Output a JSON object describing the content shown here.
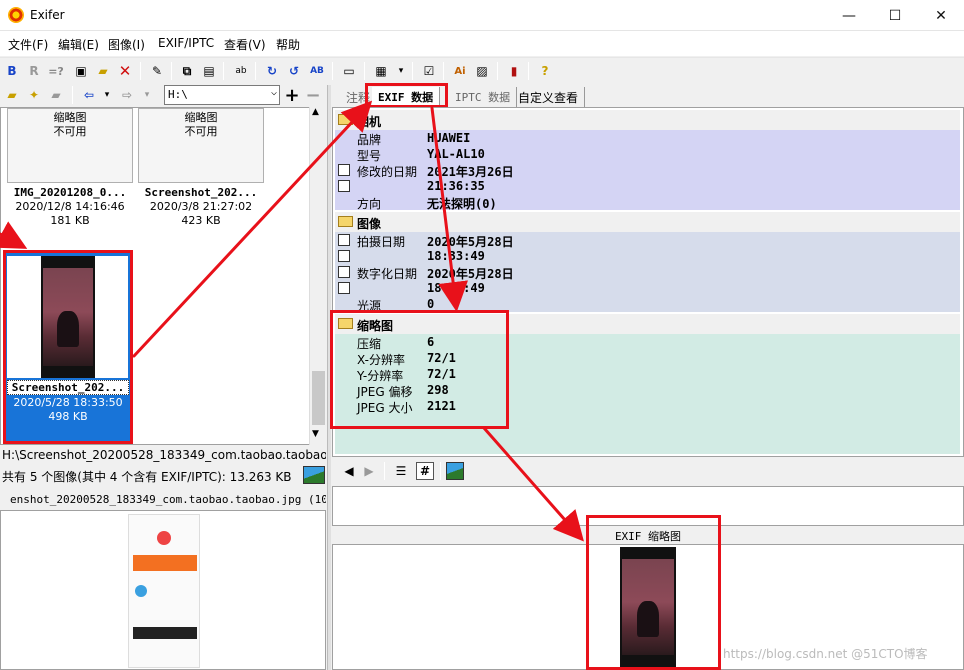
{
  "window": {
    "title": "Exifer",
    "minimize": "—",
    "maximize": "☐",
    "close": "✕"
  },
  "menu": [
    "文件(F)",
    "编辑(E)",
    "图像(I)",
    "EXIF/IPTC",
    "查看(V)",
    "帮助"
  ],
  "toolbar": {
    "btn_b": "B",
    "btn_r": "R",
    "btn_eq": "=?"
  },
  "path_combo": {
    "value": "H:\\"
  },
  "thumbnails": [
    {
      "placeholder": "缩略图\n不可用",
      "name": "IMG_20201208_0...",
      "date": "2020/12/8 14:16:46",
      "size": "181 KB"
    },
    {
      "placeholder": "缩略图\n不可用",
      "name": "Screenshot_202...",
      "date": "2020/3/8 21:27:02",
      "size": "423 KB"
    },
    {
      "name": "Screenshot_202...",
      "date": "2020/5/28 18:33:50",
      "size": "498 KB"
    }
  ],
  "status": {
    "file_path": "H:\\Screenshot_20200528_183349_com.taobao.taobao.jp",
    "count": "共有 5 个图像(其中 4 个含有 EXIF/IPTC): 13.263 KB",
    "preview_name": "enshot_20200528_183349_com.taobao.taobao.jpg (1080x2"
  },
  "tabs": [
    "注释",
    "EXIF 数据",
    "IPTC 数据",
    "自定义查看"
  ],
  "exif": {
    "camera": {
      "title": "相机",
      "rows": [
        {
          "k": "品牌",
          "v": "HUAWEI",
          "pen": false
        },
        {
          "k": "型号",
          "v": "YAL-AL10",
          "pen": false
        },
        {
          "k": "修改的日期",
          "v": "2021年3月26日",
          "pen": true
        },
        {
          "k": "",
          "v": "21:36:35",
          "pen": true
        },
        {
          "k": "方向",
          "v": "无法探明(0)",
          "pen": false
        }
      ]
    },
    "image": {
      "title": "图像",
      "rows": [
        {
          "k": "拍摄日期",
          "v": "2020年5月28日",
          "pen": true
        },
        {
          "k": "",
          "v": "18:33:49",
          "pen": true
        },
        {
          "k": "数字化日期",
          "v": "2020年5月28日",
          "pen": true
        },
        {
          "k": "",
          "v": "18:33:49",
          "pen": true
        },
        {
          "k": "光源",
          "v": "0",
          "pen": false
        }
      ]
    },
    "thumbnail": {
      "title": "缩略图",
      "rows": [
        {
          "k": "压缩",
          "v": "6"
        },
        {
          "k": "X-分辨率",
          "v": "72/1"
        },
        {
          "k": "Y-分辨率",
          "v": "72/1"
        },
        {
          "k": "JPEG 偏移",
          "v": "298"
        },
        {
          "k": "JPEG 大小",
          "v": "2121"
        }
      ]
    }
  },
  "thumb_header": "EXIF 缩略图",
  "watermark": "https://blog.csdn.net  @51CTO博客",
  "colors": {
    "camera_bg": "#d4d4f4",
    "image_bg": "#d6dceb",
    "thumb_bg": "#d2ebe4",
    "selected": "#1874d8",
    "annotation_red": "#e8111a"
  }
}
